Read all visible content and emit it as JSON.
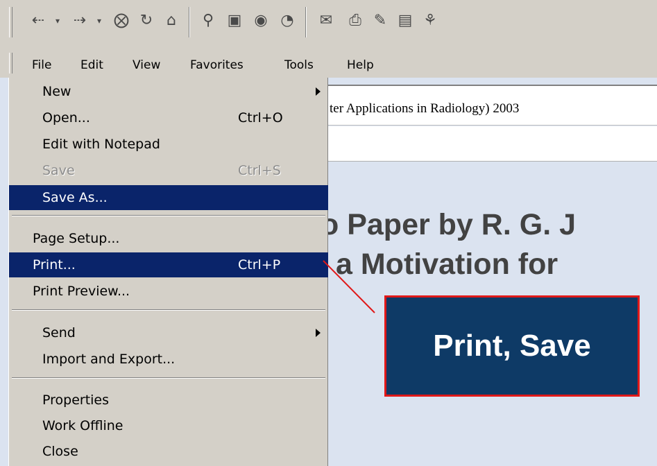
{
  "toolbar": {
    "icons": [
      "back-arrow-icon",
      "dropdown-arrow-icon",
      "forward-arrow-icon",
      "dropdown-arrow-icon",
      "stop-icon",
      "refresh-icon",
      "home-icon",
      "search-icon",
      "favorites-icon",
      "media-icon",
      "history-icon",
      "mail-icon",
      "print-icon",
      "edit-icon",
      "discuss-icon",
      "messenger-icon"
    ]
  },
  "menubar": {
    "items": [
      "File",
      "Edit",
      "View",
      "Favorites",
      "Tools",
      "Help"
    ]
  },
  "file_menu": {
    "items": [
      {
        "label": "New",
        "shortcut": "",
        "submenu": true,
        "disabled": false,
        "highlighted": false
      },
      {
        "label": "Open...",
        "shortcut": "Ctrl+O",
        "submenu": false,
        "disabled": false,
        "highlighted": false
      },
      {
        "label": "Edit with Notepad",
        "shortcut": "",
        "submenu": false,
        "disabled": false,
        "highlighted": false
      },
      {
        "label": "Save",
        "shortcut": "Ctrl+S",
        "submenu": false,
        "disabled": true,
        "highlighted": false
      },
      {
        "label": "Save As...",
        "shortcut": "",
        "submenu": false,
        "disabled": false,
        "highlighted": true
      },
      {
        "label": "Page Setup...",
        "shortcut": "",
        "submenu": false,
        "disabled": false,
        "highlighted": false
      },
      {
        "label": "Print...",
        "shortcut": "Ctrl+P",
        "submenu": false,
        "disabled": false,
        "highlighted": true
      },
      {
        "label": "Print Preview...",
        "shortcut": "",
        "submenu": false,
        "disabled": false,
        "highlighted": false
      },
      {
        "label": "Send",
        "shortcut": "",
        "submenu": true,
        "disabled": false,
        "highlighted": false
      },
      {
        "label": "Import and Export...",
        "shortcut": "",
        "submenu": false,
        "disabled": false,
        "highlighted": false
      },
      {
        "label": "Properties",
        "shortcut": "",
        "submenu": false,
        "disabled": false,
        "highlighted": false
      },
      {
        "label": "Work Offline",
        "shortcut": "",
        "submenu": false,
        "disabled": false,
        "highlighted": false
      },
      {
        "label": "Close",
        "shortcut": "",
        "submenu": false,
        "disabled": false,
        "highlighted": false
      }
    ]
  },
  "page": {
    "address_text": "ter Applications in Radiology) 2003",
    "heading_line1": "o Paper by R. G. J",
    "heading_line2": "a Motivation for"
  },
  "callout": {
    "text": "Print, Save"
  },
  "colors": {
    "menu_highlight": "#0a246a",
    "callout_bg": "#0e3a66",
    "callout_border": "#e01818",
    "slide_bg": "#dbe3f0"
  }
}
